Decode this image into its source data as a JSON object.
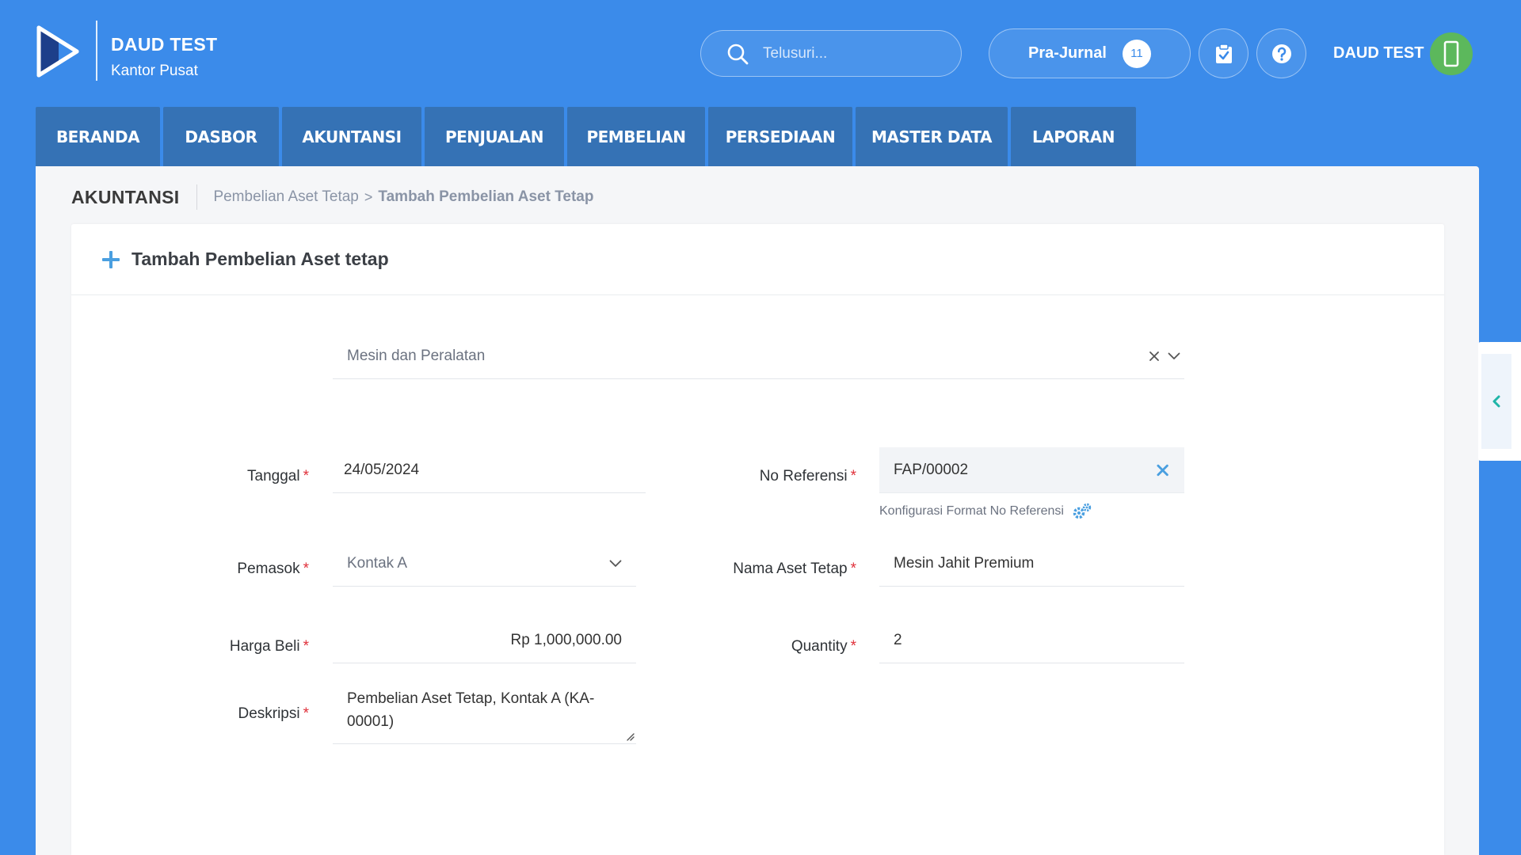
{
  "header": {
    "company_name": "DAUD TEST",
    "branch": "Kantor Pusat",
    "search_placeholder": "Telusuri...",
    "prajurnal_label": "Pra-Jurnal",
    "prajurnal_count": "11",
    "user_name": "DAUD TEST"
  },
  "nav": {
    "tabs": [
      "BERANDA",
      "DASBOR",
      "AKUNTANSI",
      "PENJUALAN",
      "PEMBELIAN",
      "PERSEDIAAN",
      "MASTER DATA",
      "LAPORAN"
    ]
  },
  "breadcrumb": {
    "section": "AKUNTANSI",
    "parent": "Pembelian Aset Tetap",
    "separator": ">",
    "current": "Tambah Pembelian Aset Tetap"
  },
  "form": {
    "title": "Tambah Pembelian Aset tetap",
    "category_value": "Mesin dan Peralatan",
    "tanggal_label": "Tanggal",
    "tanggal_value": "24/05/2024",
    "no_ref_label": "No Referensi",
    "no_ref_value": "FAP/00002",
    "config_link": "Konfigurasi Format No Referensi",
    "pemasok_label": "Pemasok",
    "pemasok_value": "Kontak A",
    "nama_aset_label": "Nama Aset Tetap",
    "nama_aset_value": "Mesin Jahit Premium",
    "harga_label": "Harga Beli",
    "harga_value": "Rp 1,000,000.00",
    "quantity_label": "Quantity",
    "quantity_value": "2",
    "deskripsi_label": "Deskripsi",
    "deskripsi_value": "Pembelian Aset Tetap, Kontak A (KA-00001)",
    "required_mark": "*"
  },
  "colors": {
    "brand_blue": "#3b8bea",
    "nav_tab": "#3572b5",
    "accent_icon": "#4a9fe0",
    "required": "#e0303a",
    "avatar": "#5cb85c",
    "side_arrow": "#1fb5a8"
  },
  "icons": {
    "logo": "play-logo-icon",
    "search": "search-icon",
    "tasks": "clipboard-check-icon",
    "help": "question-circle-icon",
    "avatar": "mobile-phone-icon",
    "add": "plus-icon",
    "clear": "close-icon",
    "dropdown": "chevron-down-icon",
    "config": "gears-icon",
    "collapse": "chevron-left-icon"
  }
}
